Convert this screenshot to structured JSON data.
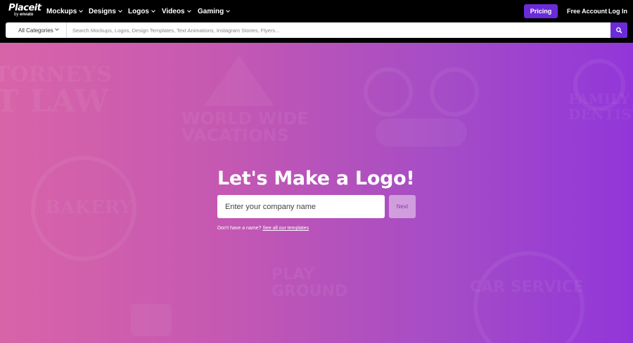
{
  "header": {
    "logo": {
      "main": "Placeit",
      "by": "by",
      "brand": "envato"
    },
    "nav": [
      {
        "label": "Mockups"
      },
      {
        "label": "Designs"
      },
      {
        "label": "Logos"
      },
      {
        "label": "Videos"
      },
      {
        "label": "Gaming"
      }
    ],
    "pricing_label": "Pricing",
    "free_account_label": "Free Account",
    "login_label": "Log In",
    "accent_color": "#6b2bd9"
  },
  "search": {
    "category": "All Categories",
    "placeholder": "Search Mockups, Logos, Design Templates, Text Animations, Instagram Stories, Flyers...",
    "icon": "search-icon"
  },
  "hero": {
    "title": "Let's Make a Logo!",
    "input_placeholder": "Enter your company name",
    "next_label": "Next",
    "help_text": "Don't have a name?",
    "help_link": "See all our templates",
    "background_logos": [
      "TORNEYS",
      "T LAW",
      "WORLD WIDE",
      "VACATIONS",
      "BAKERY",
      "FAMILY",
      "DENTIST",
      "PLAY",
      "GROUND",
      "CAR SERVICE"
    ]
  }
}
